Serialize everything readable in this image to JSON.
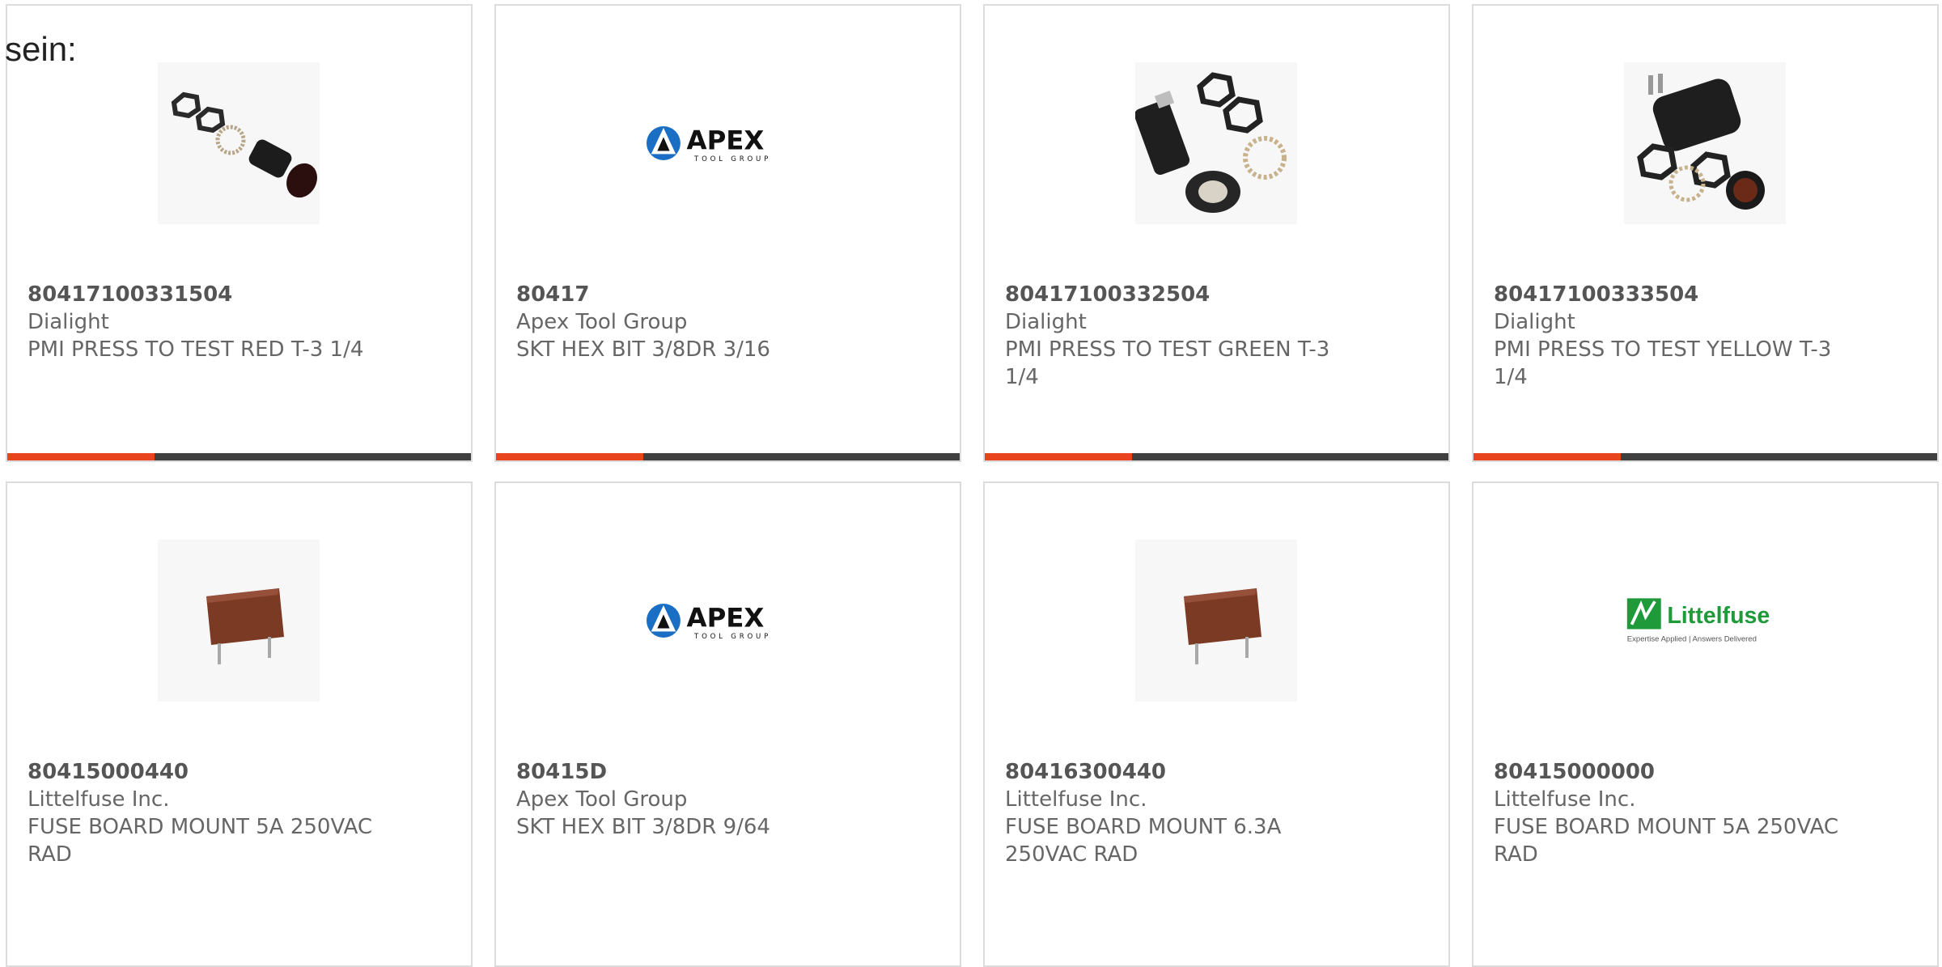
{
  "intro_text": "sein:",
  "colors": {
    "accent": "#e8441d",
    "bar": "#404040",
    "border": "#dcdcdc",
    "text": "#666666"
  },
  "products": [
    {
      "part_number": "80417100331504",
      "manufacturer": "Dialight",
      "description": "PMI PRESS TO TEST RED T-3 1/4",
      "image": "fuse-holder-kit-icon"
    },
    {
      "part_number": "80417",
      "manufacturer": "Apex Tool Group",
      "description": "SKT HEX BIT 3/8DR 3/16",
      "image": "apex-logo-icon",
      "logo_text": "APEX",
      "logo_sub": "TOOL GROUP"
    },
    {
      "part_number": "80417100332504",
      "manufacturer": "Dialight",
      "description": "PMI PRESS TO TEST GREEN T-3 1/4",
      "image": "fuse-holder-kit-icon"
    },
    {
      "part_number": "80417100333504",
      "manufacturer": "Dialight",
      "description": "PMI PRESS TO TEST YELLOW T-3 1/4",
      "image": "fuse-holder-kit-icon"
    },
    {
      "part_number": "80415000440",
      "manufacturer": "Littelfuse Inc.",
      "description": "FUSE BOARD MOUNT 5A 250VAC RAD",
      "image": "board-fuse-icon"
    },
    {
      "part_number": "80415D",
      "manufacturer": "Apex Tool Group",
      "description": "SKT HEX BIT 3/8DR 9/64",
      "image": "apex-logo-icon",
      "logo_text": "APEX",
      "logo_sub": "TOOL GROUP"
    },
    {
      "part_number": "80416300440",
      "manufacturer": "Littelfuse Inc.",
      "description": "FUSE BOARD MOUNT 6.3A 250VAC RAD",
      "image": "board-fuse-icon"
    },
    {
      "part_number": "80415000000",
      "manufacturer": "Littelfuse Inc.",
      "description": "FUSE BOARD MOUNT 5A 250VAC RAD",
      "image": "littelfuse-logo-icon",
      "logo_text": "Littelfuse",
      "logo_sub": "Expertise Applied | Answers Delivered"
    }
  ]
}
